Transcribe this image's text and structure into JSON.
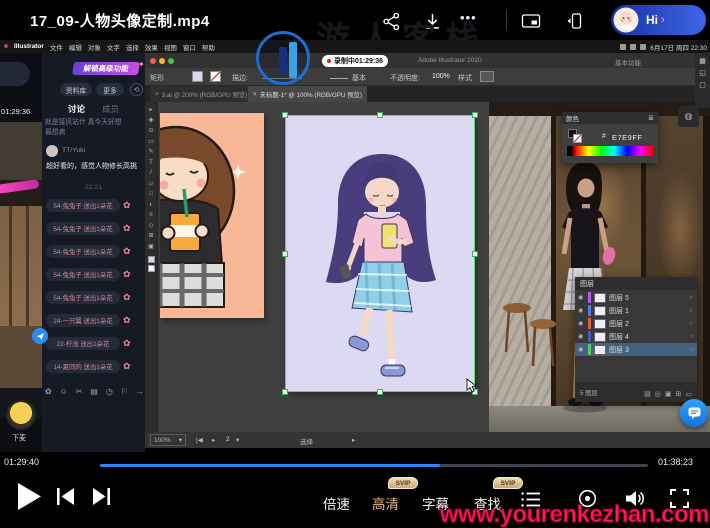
{
  "top_bar": {
    "title": "17_09-人物头像定制.mp4",
    "more": "•••",
    "user": {
      "name": "Hi",
      "chevron": "›"
    }
  },
  "brand": {
    "logo_text": "游人客栈"
  },
  "video": {
    "menu": {
      "items": [
        "Illustrator",
        "文件",
        "编辑",
        "对象",
        "文字",
        "选择",
        "效果",
        "视图",
        "窗口",
        "帮助"
      ],
      "clock": "6月17日 周四 22:30"
    },
    "window": {
      "recording": "录制中01:29:36",
      "app_title": "Adobe Illustrator 2020",
      "workspace": "基本功能"
    },
    "control_bar": {
      "selection_label": "矩形",
      "stroke_label": "描边:",
      "basic_label": "基本",
      "opacity_label": "不透明度:",
      "opacity_value": "100%",
      "style_label": "样式"
    },
    "doc_tabs": [
      {
        "close": "×",
        "label": "3.ai @ 200% (RGB/GPU 预览)"
      },
      {
        "close": "×",
        "label": "未标题-1* @ 100% (RGB/GPU 预览)"
      }
    ],
    "status_bar": {
      "zoom": "100%",
      "caret": "▾",
      "nav_prev": "|◀",
      "nav_next": "▸",
      "artboard": "2",
      "tool": "选择",
      "arrow": "▸"
    },
    "panels": {
      "color": {
        "title": "颜色",
        "menu_icon": "≣",
        "hex_prefix": "#",
        "hex": "E7E9FF"
      },
      "layers": {
        "title": "图层",
        "rows": [
          {
            "name": "图层 5",
            "color": "#b45ce8"
          },
          {
            "name": "图层 1",
            "color": "#5878e8"
          },
          {
            "name": "图层 2",
            "color": "#e06040"
          },
          {
            "name": "图层 4",
            "color": "#4a58c8"
          },
          {
            "name": "图层 3",
            "color": "#58c868"
          }
        ],
        "count": "5 图层"
      }
    }
  },
  "sidebar": {
    "banner": "解锁高级功能",
    "library_btn": "资料库",
    "more_btn": "更多",
    "refresh_icon": "⟲",
    "tabs": {
      "active": "讨论",
      "inactive": "成员"
    },
    "pinned": {
      "line1": "就是接风站什 真今天好想",
      "line2": "最想疯"
    },
    "chat": {
      "user": "TT/Yuki",
      "message": "超好看的，感觉人物修长高挑",
      "time": "22:21"
    },
    "gifts": [
      "54-兔兔子 送出1朵花",
      "54-兔兔子 送出1朵花",
      "54-兔兔子 送出1朵花",
      "54-兔兔子 送出1朵花",
      "54-兔兔子 送出1朵花",
      "24-一只翼 送出1朵花",
      "22-柠浅 送出1朵花",
      "14-夏同的 送出1朵花"
    ],
    "preview_time": "01:29:36",
    "mic_label": "下麦"
  },
  "player": {
    "current_time": "01:29:40",
    "duration": "01:38:23",
    "progress_percent": 62,
    "speed": "倍速",
    "quality": "高清",
    "subtitle": "字幕",
    "find": "查找",
    "svip": "SVIP",
    "watermark": "www.yourenkezhan.com",
    "colors": {
      "progress": "#2b87f5",
      "quality_active": "#e8b87a",
      "watermark": "#ff1a55"
    }
  }
}
